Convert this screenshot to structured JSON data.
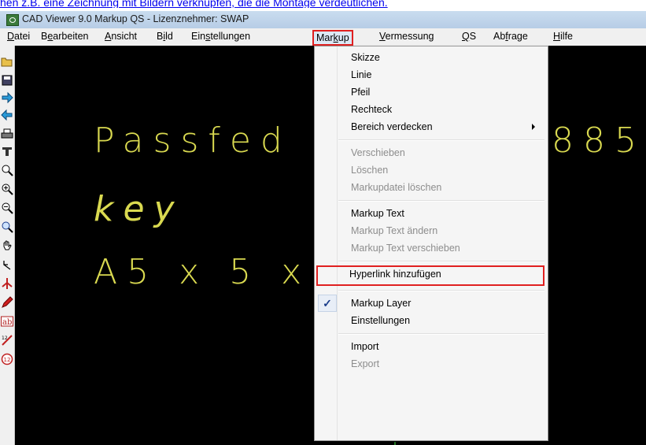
{
  "top_link": {
    "text": "hen z.B. eine Zeichnung mit Bildern verknüpfen, die die Montage verdeutlichen.",
    "color": "#0000ee"
  },
  "window": {
    "title": "CAD Viewer 9.0 Markup QS - Lizenznehmer: SWAP",
    "icon": "cad-viewer-app-icon"
  },
  "menubar": {
    "items": [
      {
        "label": "Datei",
        "accel": "D"
      },
      {
        "label": "Bearbeiten",
        "accel": "e"
      },
      {
        "label": "Ansicht",
        "accel": "A"
      },
      {
        "label": "Bild",
        "accel": "i"
      },
      {
        "label": "Einstellungen",
        "accel": "s"
      },
      {
        "label": "Markup",
        "accel": "k",
        "active": true
      },
      {
        "label": "Vermessung",
        "accel": "V"
      },
      {
        "label": "QS",
        "accel": "Q"
      },
      {
        "label": "Abfrage",
        "accel": "f"
      },
      {
        "label": "Hilfe",
        "accel": "H"
      }
    ]
  },
  "toolbar": {
    "icons": [
      "open-folder-icon",
      "save-disk-icon",
      "arrow-right-icon",
      "arrow-left-icon",
      "printer-icon",
      "measure-icon",
      "zoom-icon",
      "zoom-in-icon",
      "zoom-out-icon",
      "zoom-fit-icon",
      "pan-hand-icon",
      "undo-arrow-icon",
      "move-axes-icon",
      "pencil-icon",
      "text-ab-icon",
      "dimension-icon",
      "number-12-icon"
    ]
  },
  "drawing": {
    "line1": "Passfed",
    "line1_end": "885",
    "line2": "key",
    "line3": "A5 x 5 x",
    "text_color": "#d9d950"
  },
  "markup_menu": {
    "items": [
      {
        "label": "Skizze",
        "disabled": false
      },
      {
        "label": "Linie",
        "disabled": false
      },
      {
        "label": "Pfeil",
        "disabled": false
      },
      {
        "label": "Rechteck",
        "disabled": false
      },
      {
        "label": "Bereich verdecken",
        "disabled": false,
        "submenu": true
      },
      {
        "label": "Verschieben",
        "disabled": true
      },
      {
        "label": "Löschen",
        "disabled": true
      },
      {
        "label": "Markupdatei löschen",
        "disabled": true
      },
      {
        "label": "Markup Text",
        "disabled": false
      },
      {
        "label": "Markup Text ändern",
        "disabled": true
      },
      {
        "label": "Markup Text verschieben",
        "disabled": true
      },
      {
        "label": "Hyperlink hinzufügen",
        "disabled": false,
        "highlighted": true
      },
      {
        "label": "Markup Layer",
        "disabled": false,
        "checked": true
      },
      {
        "label": "Einstellungen",
        "disabled": false
      },
      {
        "label": "Import",
        "disabled": false
      },
      {
        "label": "Export",
        "disabled": true
      }
    ]
  },
  "highlight_color": "#e02020"
}
